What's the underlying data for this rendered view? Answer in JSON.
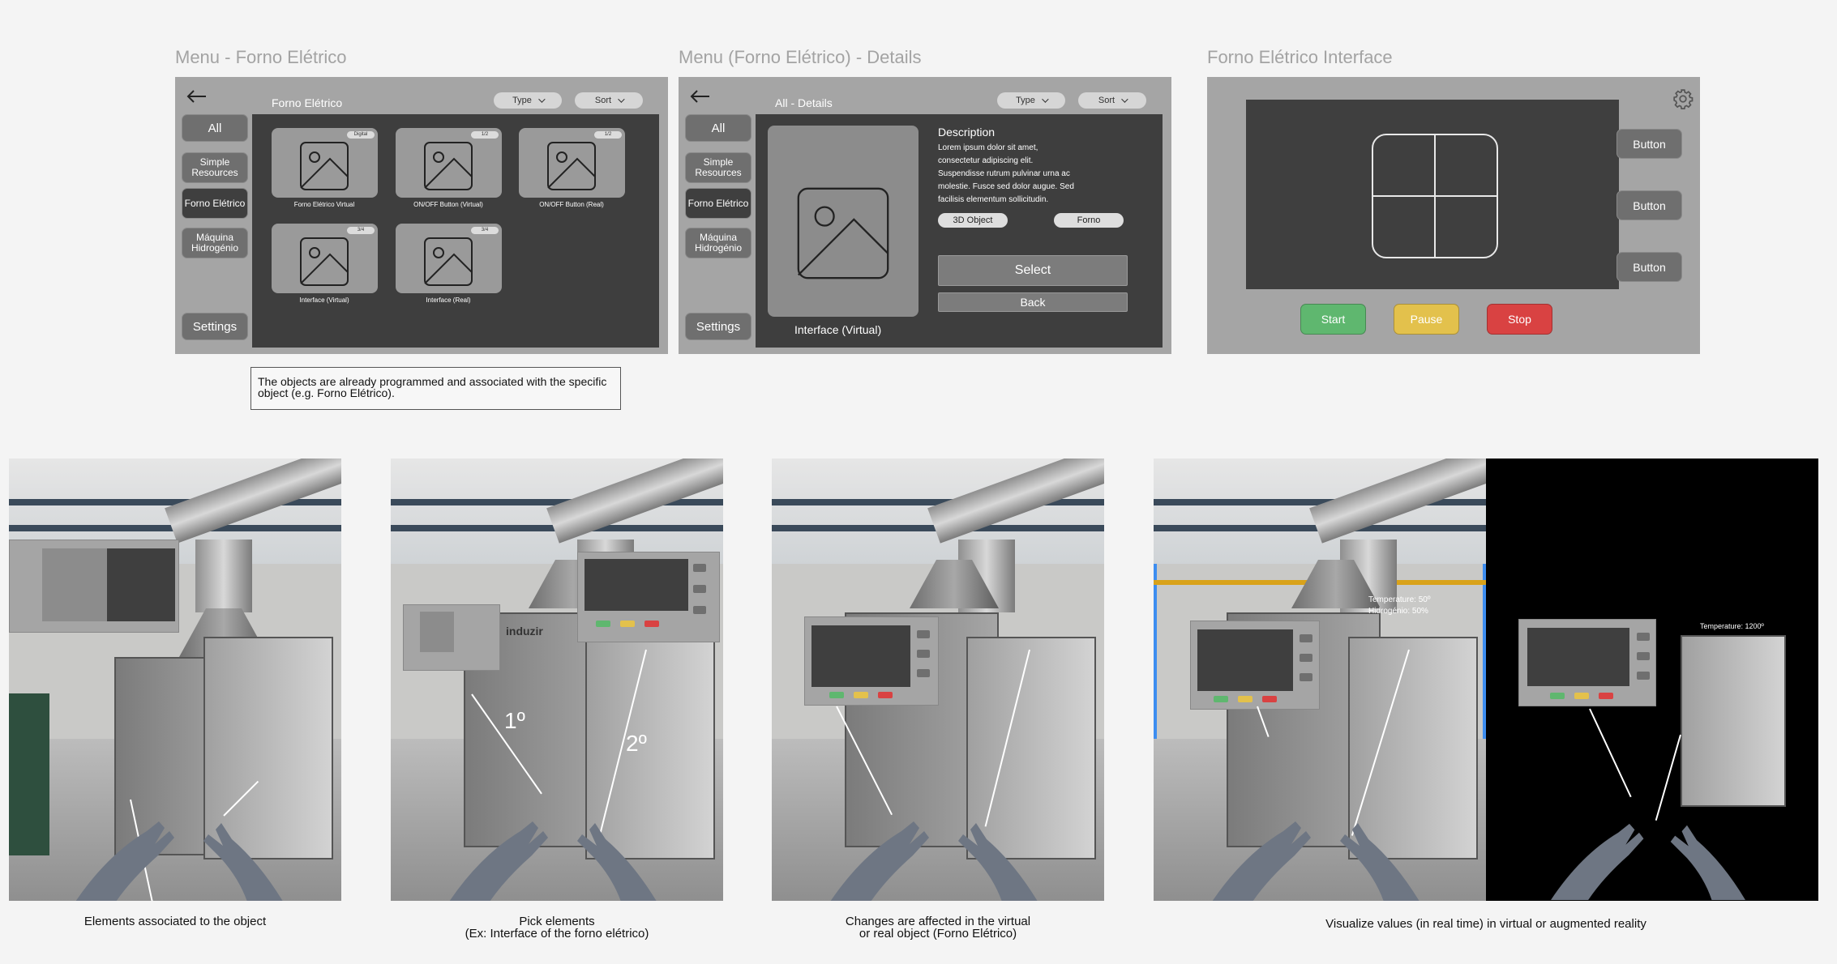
{
  "frames": {
    "menu": {
      "title": "Menu - Forno Elétrico",
      "header_title": "Forno Elétrico",
      "type_label": "Type",
      "sort_label": "Sort",
      "sidebar": [
        "All",
        "Simple Resources",
        "Forno Elétrico",
        "Máquina Hidrogénio"
      ],
      "settings_label": "Settings",
      "cards": [
        {
          "label": "Forno Elétrico Virtual",
          "badge": "Digital"
        },
        {
          "label": "ON/OFF Button (Virtual)",
          "badge": "1/2"
        },
        {
          "label": "ON/OFF Button (Real)",
          "badge": "1/2"
        },
        {
          "label": "Interface (Virtual)",
          "badge": "3/4"
        },
        {
          "label": "Interface (Real)",
          "badge": "3/4"
        }
      ]
    },
    "details": {
      "title": "Menu (Forno Elétrico) - Details",
      "header_title": "All - Details",
      "type_label": "Type",
      "sort_label": "Sort",
      "sidebar": [
        "All",
        "Simple Resources",
        "Forno Elétrico",
        "Máquina Hidrogénio"
      ],
      "settings_label": "Settings",
      "image_caption": "Interface (Virtual)",
      "description_title": "Description",
      "description_text": "Lorem ipsum dolor sit amet, consectetur adipiscing elit. Suspendisse rutrum pulvinar urna ac molestie. Fusce sed dolor augue. Sed facilisis elementum sollicitudin.",
      "tag_1": "3D Object",
      "tag_2": "Forno",
      "select_label": "Select",
      "back_label": "Back"
    },
    "interface": {
      "title": "Forno Elétrico Interface",
      "side_buttons": [
        "Button",
        "Button",
        "Button"
      ],
      "start_label": "Start",
      "pause_label": "Pause",
      "stop_label": "Stop",
      "colors": {
        "start": "#5fb76f",
        "pause": "#e3c14c",
        "stop": "#d94242"
      }
    }
  },
  "note": "The objects are already programmed and associated with the specific object (e.g. Forno Elétrico).",
  "photos": {
    "p1_caption": "Elements associated to the object",
    "p2_caption_line1": "Pick elements",
    "p2_caption_line2": "(Ex: Interface of the forno elétrico)",
    "p2_ordinal_1": "1º",
    "p2_ordinal_2": "2º",
    "p2_logo": "induzir",
    "p3_caption_line1": "Changes are affected in the virtual",
    "p3_caption_line2": "or real object (Forno Elétrico)",
    "p4_caption": "Visualize values (in real time) in virtual or augmented reality",
    "p4_ar_temp": "Temperature: 50º",
    "p4_ar_hydrogen": "Hidrogénio: 50%",
    "p5_vr_temp": "Temperature: 1200º"
  }
}
